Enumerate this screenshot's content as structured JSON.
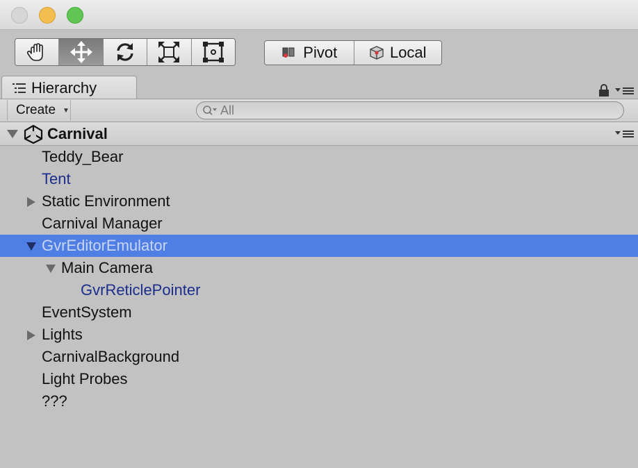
{
  "window": {
    "controls": [
      "close",
      "minimize",
      "maximize"
    ]
  },
  "toolbar": {
    "tools": [
      {
        "icon": "hand-icon",
        "active": false
      },
      {
        "icon": "move-icon",
        "active": true
      },
      {
        "icon": "rotate-icon",
        "active": false
      },
      {
        "icon": "scale-icon",
        "active": false
      },
      {
        "icon": "rect-tool-icon",
        "active": false
      }
    ],
    "pivot_label": "Pivot",
    "local_label": "Local"
  },
  "tab": {
    "label": "Hierarchy",
    "icon": "list-icon"
  },
  "createbar": {
    "create_label": "Create",
    "search_placeholder": "All"
  },
  "scene": {
    "name": "Carnival",
    "icon": "unity-icon",
    "expanded": true
  },
  "items": [
    {
      "label": "Teddy_Bear",
      "depth": 1,
      "expander": "none",
      "prefab": false,
      "selected": false
    },
    {
      "label": "Tent",
      "depth": 1,
      "expander": "none",
      "prefab": true,
      "selected": false
    },
    {
      "label": "Static Environment",
      "depth": 1,
      "expander": "collapsed",
      "prefab": false,
      "selected": false
    },
    {
      "label": "Carnival Manager",
      "depth": 1,
      "expander": "none",
      "prefab": false,
      "selected": false
    },
    {
      "label": "GvrEditorEmulator",
      "depth": 1,
      "expander": "expanded",
      "prefab": false,
      "selected": true
    },
    {
      "label": "Main Camera",
      "depth": 2,
      "expander": "expanded",
      "prefab": false,
      "selected": false
    },
    {
      "label": "GvrReticlePointer",
      "depth": 3,
      "expander": "none",
      "prefab": true,
      "selected": false
    },
    {
      "label": "EventSystem",
      "depth": 1,
      "expander": "none",
      "prefab": false,
      "selected": false
    },
    {
      "label": "Lights",
      "depth": 1,
      "expander": "collapsed",
      "prefab": false,
      "selected": false
    },
    {
      "label": "CarnivalBackground",
      "depth": 1,
      "expander": "none",
      "prefab": false,
      "selected": false
    },
    {
      "label": "Light Probes",
      "depth": 1,
      "expander": "none",
      "prefab": false,
      "selected": false
    },
    {
      "label": "???",
      "depth": 1,
      "expander": "none",
      "prefab": false,
      "selected": false
    }
  ],
  "colors": {
    "selection": "#4f7fe5",
    "prefab_text": "#1b2d8c",
    "panel_bg": "#c2c2c2"
  }
}
